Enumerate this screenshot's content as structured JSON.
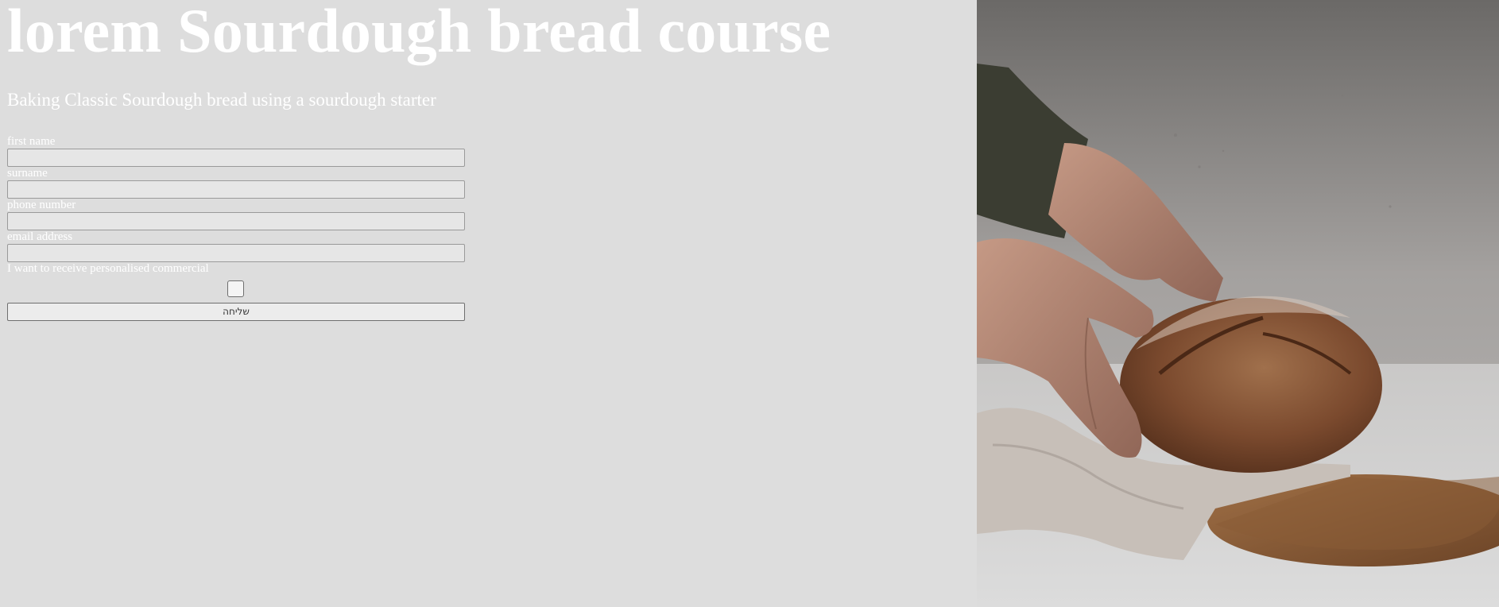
{
  "header": {
    "title": "lorem Sourdough bread course",
    "subtitle": "Baking Classic Sourdough bread using a sourdough starter"
  },
  "form": {
    "first_name_label": "first name",
    "first_name_value": "",
    "surname_label": "surname",
    "surname_value": "",
    "phone_label": "phone number",
    "phone_value": "",
    "email_label": "email address",
    "email_value": "",
    "consent_label": "I want to receive personalised commercial",
    "consent_checked": false,
    "submit_label": "שליחה"
  },
  "photo": {
    "subject": "hands holding sourdough loaf on wooden board with linen cloth"
  },
  "colors": {
    "page_background": "#dddddd",
    "text": "#ffffff"
  }
}
